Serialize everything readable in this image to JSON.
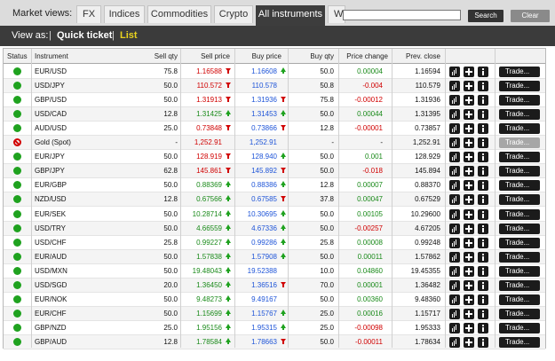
{
  "market_views": {
    "label": "Market views:",
    "tabs": [
      "FX",
      "Indices",
      "Commodities",
      "Crypto",
      "All instruments",
      "W"
    ],
    "active_tab": "All instruments",
    "search_value": "",
    "search_button": "Search",
    "clear_button": "Clear"
  },
  "view_as": {
    "label": "View as:",
    "separator": "|",
    "quick_ticket": "Quick ticket",
    "list": "List"
  },
  "columns": {
    "status": "Status",
    "instrument": "Instrument",
    "sell_qty": "Sell qty",
    "sell_price": "Sell price",
    "buy_price": "Buy price",
    "buy_qty": "Buy qty",
    "price_change": "Price change",
    "prev_close": "Prev. close"
  },
  "trade_label": "Trade...",
  "colors": {
    "green": "#1fa21f",
    "red": "#d00000",
    "blue": "#1f55d8",
    "dark": "#3b3b3b",
    "active_list": "#e9d21e"
  },
  "icons": [
    "bar-chart-icon",
    "plus-icon",
    "info-icon"
  ],
  "rows": [
    {
      "status": "open",
      "instrument": "EUR/USD",
      "sell_qty": "75.8",
      "sell_price": "1.16588",
      "sell_dir": "down",
      "buy_price": "1.16608",
      "buy_dir": "up",
      "buy_qty": "50.0",
      "change": "0.00004",
      "change_dir": "up",
      "prev_close": "1.16594"
    },
    {
      "status": "open",
      "instrument": "USD/JPY",
      "sell_qty": "50.0",
      "sell_price": "110.572",
      "sell_dir": "down",
      "buy_price": "110.578",
      "buy_dir": "none",
      "buy_qty": "50.8",
      "change": "-0.004",
      "change_dir": "down",
      "prev_close": "110.579"
    },
    {
      "status": "open",
      "instrument": "GBP/USD",
      "sell_qty": "50.0",
      "sell_price": "1.31913",
      "sell_dir": "down",
      "buy_price": "1.31936",
      "buy_dir": "down",
      "buy_qty": "75.8",
      "change": "-0.00012",
      "change_dir": "down",
      "prev_close": "1.31936"
    },
    {
      "status": "open",
      "instrument": "USD/CAD",
      "sell_qty": "12.8",
      "sell_price": "1.31425",
      "sell_dir": "up",
      "buy_price": "1.31453",
      "buy_dir": "up",
      "buy_qty": "50.0",
      "change": "0.00044",
      "change_dir": "up",
      "prev_close": "1.31395"
    },
    {
      "status": "open",
      "instrument": "AUD/USD",
      "sell_qty": "25.0",
      "sell_price": "0.73848",
      "sell_dir": "down",
      "buy_price": "0.73866",
      "buy_dir": "down",
      "buy_qty": "12.8",
      "change": "-0.00001",
      "change_dir": "down",
      "prev_close": "0.73857"
    },
    {
      "status": "closed",
      "instrument": "Gold (Spot)",
      "sell_qty": "-",
      "sell_price": "1,252.91",
      "sell_dir": "none",
      "buy_price": "1,252.91",
      "buy_dir": "none",
      "buy_qty": "-",
      "change": "-",
      "change_dir": "none",
      "prev_close": "1,252.91"
    },
    {
      "status": "open",
      "instrument": "EUR/JPY",
      "sell_qty": "50.0",
      "sell_price": "128.919",
      "sell_dir": "down",
      "buy_price": "128.940",
      "buy_dir": "up",
      "buy_qty": "50.0",
      "change": "0.001",
      "change_dir": "up",
      "prev_close": "128.929"
    },
    {
      "status": "open",
      "instrument": "GBP/JPY",
      "sell_qty": "62.8",
      "sell_price": "145.861",
      "sell_dir": "down",
      "buy_price": "145.892",
      "buy_dir": "down",
      "buy_qty": "50.0",
      "change": "-0.018",
      "change_dir": "down",
      "prev_close": "145.894"
    },
    {
      "status": "open",
      "instrument": "EUR/GBP",
      "sell_qty": "50.0",
      "sell_price": "0.88369",
      "sell_dir": "up",
      "buy_price": "0.88386",
      "buy_dir": "up",
      "buy_qty": "12.8",
      "change": "0.00007",
      "change_dir": "up",
      "prev_close": "0.88370"
    },
    {
      "status": "open",
      "instrument": "NZD/USD",
      "sell_qty": "12.8",
      "sell_price": "0.67566",
      "sell_dir": "up",
      "buy_price": "0.67585",
      "buy_dir": "down",
      "buy_qty": "37.8",
      "change": "0.00047",
      "change_dir": "up",
      "prev_close": "0.67529"
    },
    {
      "status": "open",
      "instrument": "EUR/SEK",
      "sell_qty": "50.0",
      "sell_price": "10.28714",
      "sell_dir": "up",
      "buy_price": "10.30695",
      "buy_dir": "up",
      "buy_qty": "50.0",
      "change": "0.00105",
      "change_dir": "up",
      "prev_close": "10.29600"
    },
    {
      "status": "open",
      "instrument": "USD/TRY",
      "sell_qty": "50.0",
      "sell_price": "4.66559",
      "sell_dir": "up",
      "buy_price": "4.67336",
      "buy_dir": "up",
      "buy_qty": "50.0",
      "change": "-0.00257",
      "change_dir": "down",
      "prev_close": "4.67205"
    },
    {
      "status": "open",
      "instrument": "USD/CHF",
      "sell_qty": "25.8",
      "sell_price": "0.99227",
      "sell_dir": "up",
      "buy_price": "0.99286",
      "buy_dir": "up",
      "buy_qty": "25.8",
      "change": "0.00008",
      "change_dir": "up",
      "prev_close": "0.99248"
    },
    {
      "status": "open",
      "instrument": "EUR/AUD",
      "sell_qty": "50.0",
      "sell_price": "1.57838",
      "sell_dir": "up",
      "buy_price": "1.57908",
      "buy_dir": "up",
      "buy_qty": "50.0",
      "change": "0.00011",
      "change_dir": "up",
      "prev_close": "1.57862"
    },
    {
      "status": "open",
      "instrument": "USD/MXN",
      "sell_qty": "50.0",
      "sell_price": "19.48043",
      "sell_dir": "up",
      "buy_price": "19.52388",
      "buy_dir": "none",
      "buy_qty": "10.0",
      "change": "0.04860",
      "change_dir": "up",
      "prev_close": "19.45355"
    },
    {
      "status": "open",
      "instrument": "USD/SGD",
      "sell_qty": "20.0",
      "sell_price": "1.36450",
      "sell_dir": "up",
      "buy_price": "1.36516",
      "buy_dir": "down",
      "buy_qty": "70.0",
      "change": "0.00001",
      "change_dir": "up",
      "prev_close": "1.36482"
    },
    {
      "status": "open",
      "instrument": "EUR/NOK",
      "sell_qty": "50.0",
      "sell_price": "9.48273",
      "sell_dir": "up",
      "buy_price": "9.49167",
      "buy_dir": "none",
      "buy_qty": "50.0",
      "change": "0.00360",
      "change_dir": "up",
      "prev_close": "9.48360"
    },
    {
      "status": "open",
      "instrument": "EUR/CHF",
      "sell_qty": "50.0",
      "sell_price": "1.15699",
      "sell_dir": "up",
      "buy_price": "1.15767",
      "buy_dir": "up",
      "buy_qty": "25.0",
      "change": "0.00016",
      "change_dir": "up",
      "prev_close": "1.15717"
    },
    {
      "status": "open",
      "instrument": "GBP/NZD",
      "sell_qty": "25.0",
      "sell_price": "1.95156",
      "sell_dir": "up",
      "buy_price": "1.95315",
      "buy_dir": "up",
      "buy_qty": "25.0",
      "change": "-0.00098",
      "change_dir": "down",
      "prev_close": "1.95333"
    },
    {
      "status": "open",
      "instrument": "GBP/AUD",
      "sell_qty": "12.8",
      "sell_price": "1.78584",
      "sell_dir": "up",
      "buy_price": "1.78663",
      "buy_dir": "down",
      "buy_qty": "50.0",
      "change": "-0.00011",
      "change_dir": "down",
      "prev_close": "1.78634"
    }
  ]
}
